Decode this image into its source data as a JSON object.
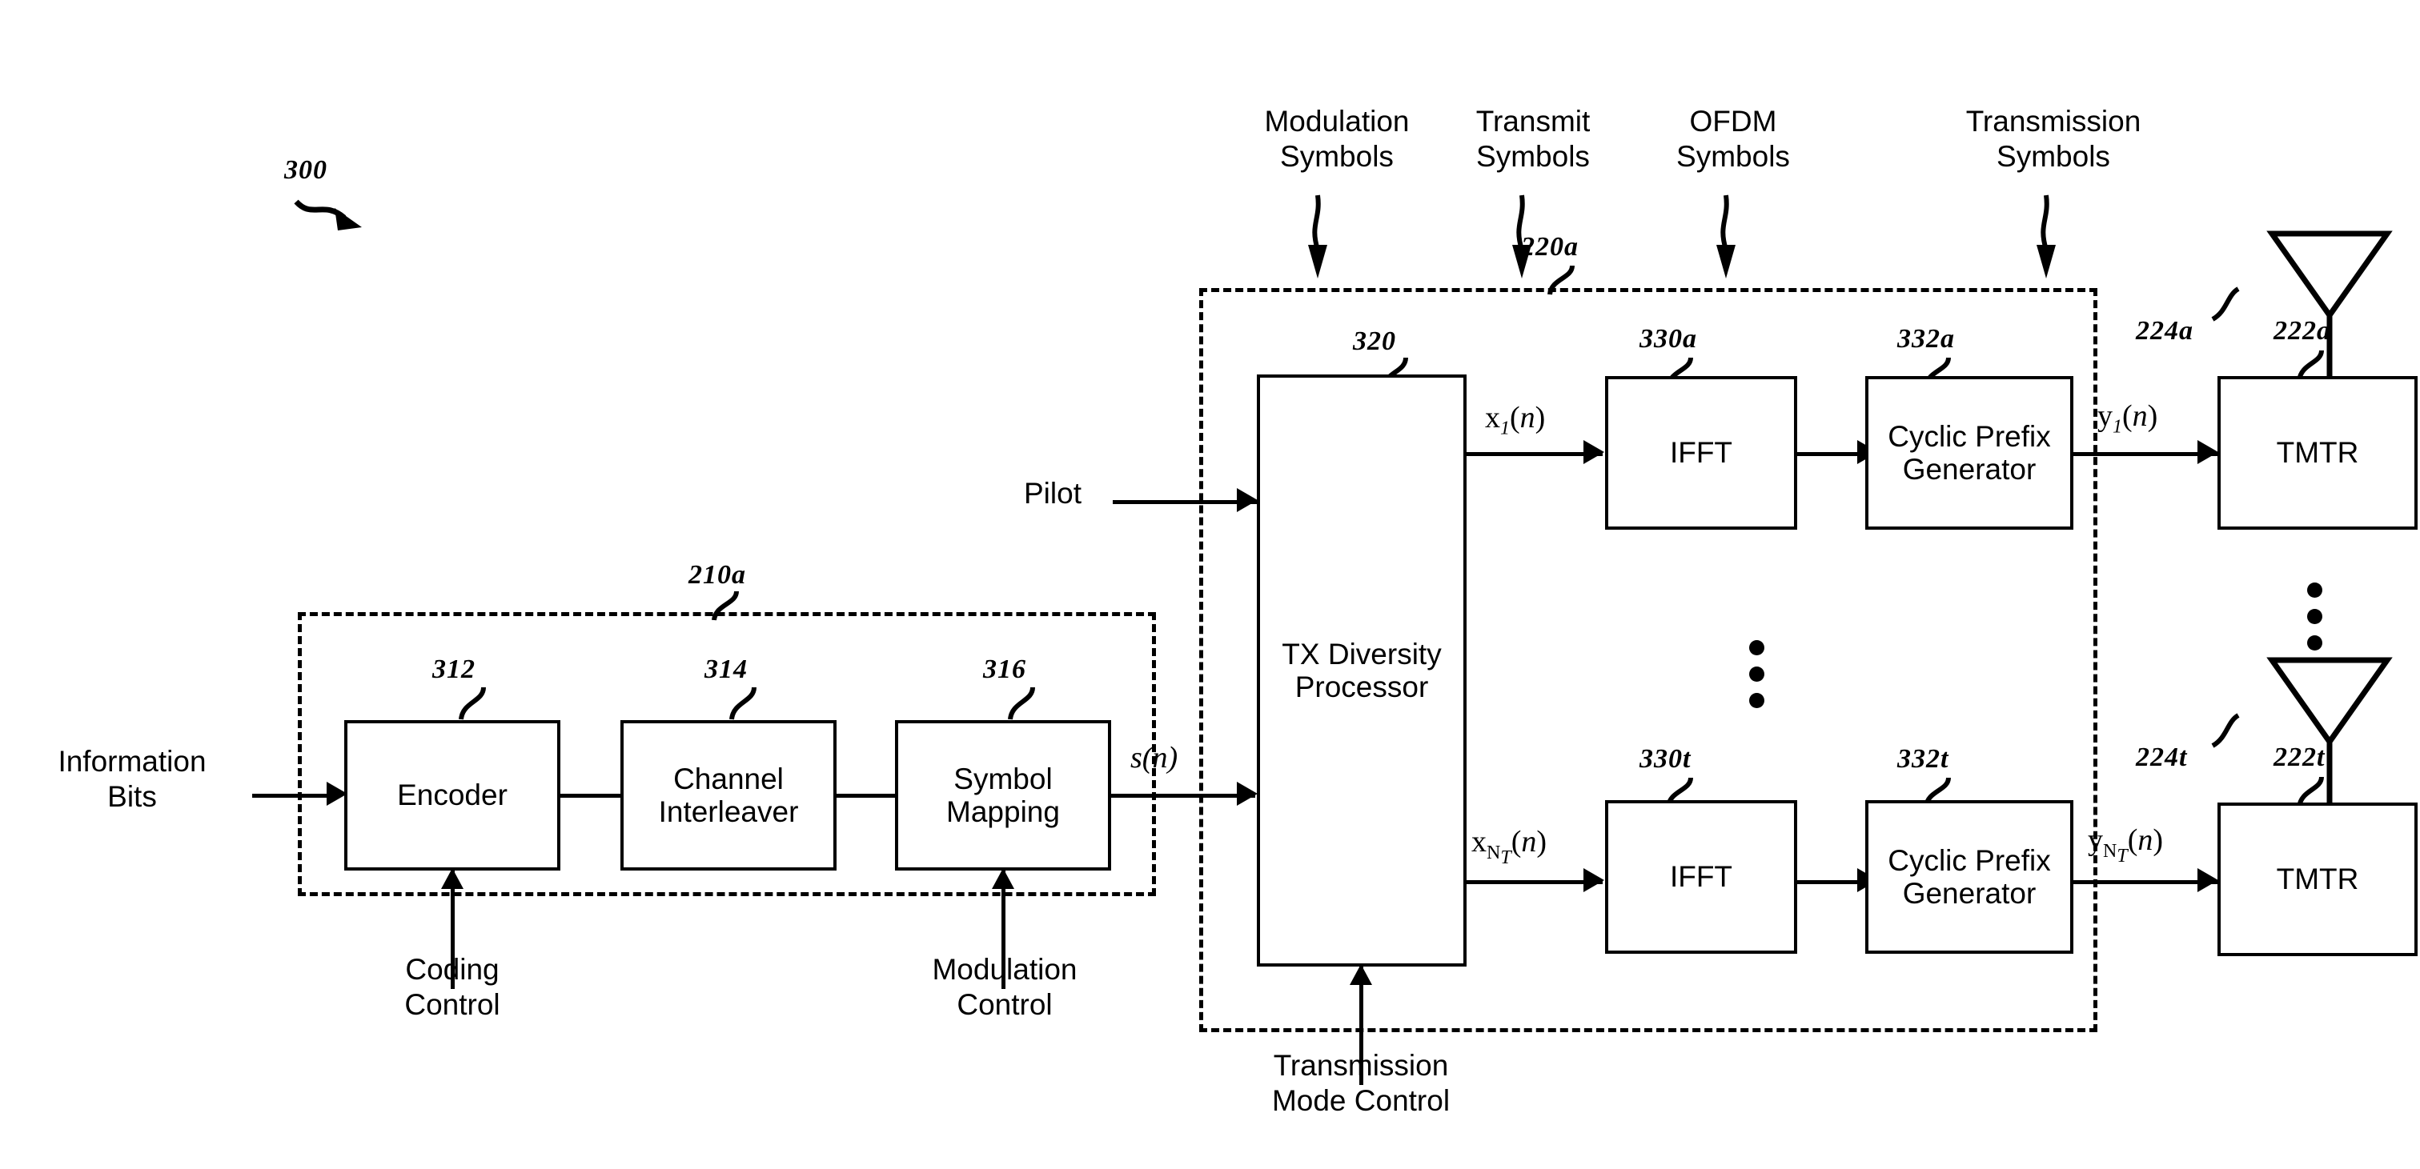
{
  "figure": {
    "number": "300",
    "top_labels": [
      {
        "text": "Modulation\nSymbols"
      },
      {
        "text": "Transmit\nSymbols"
      },
      {
        "text": "OFDM\nSymbols"
      },
      {
        "text": "Transmission\nSymbols"
      }
    ]
  },
  "tx_data_processor": {
    "ref": "210a",
    "blocks": [
      {
        "ref": "312",
        "label": "Encoder"
      },
      {
        "ref": "314",
        "label": "Channel\nInterleaver"
      },
      {
        "ref": "316",
        "label": "Symbol\nMapping"
      }
    ],
    "input_label": "Information\nBits",
    "output_signal": "s(n)",
    "controls": [
      {
        "label": "Coding\nControl"
      },
      {
        "label": "Modulation\nControl"
      }
    ]
  },
  "tx_spatial_processor": {
    "ref": "220a",
    "processor": {
      "ref": "320",
      "label": "TX\nDiversity\nProcessor"
    },
    "pilot_label": "Pilot",
    "control_label": "Transmission\nMode Control",
    "chains": [
      {
        "input_signal": "x1(n)",
        "ifft": {
          "ref": "330a",
          "label": "IFFT"
        },
        "cyclic": {
          "ref": "332a",
          "label": "Cyclic\nPrefix\nGenerator"
        },
        "output_signal": "y1(n)"
      },
      {
        "input_signal": "xNT(n)",
        "ifft": {
          "ref": "330t",
          "label": "IFFT"
        },
        "cyclic": {
          "ref": "332t",
          "label": "Cyclic\nPrefix\nGenerator"
        },
        "output_signal": "yNT(n)"
      }
    ]
  },
  "transmitters": [
    {
      "label": "TMTR",
      "tmtr_ref": "222a",
      "antenna_ref": "224a"
    },
    {
      "label": "TMTR",
      "tmtr_ref": "222t",
      "antenna_ref": "224t"
    }
  ]
}
